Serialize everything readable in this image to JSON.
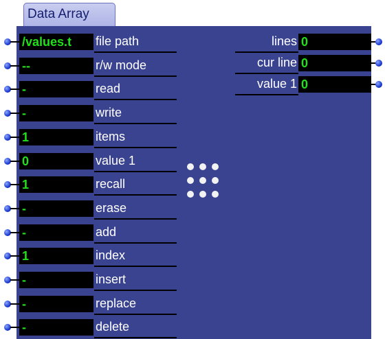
{
  "title": "Data Array",
  "inputs": [
    {
      "value": "/values.t",
      "label": "file path"
    },
    {
      "value": "--",
      "label": "r/w mode"
    },
    {
      "value": "-",
      "label": "read"
    },
    {
      "value": "-",
      "label": "write"
    },
    {
      "value": "1",
      "label": "items"
    },
    {
      "value": "0",
      "label": "value 1"
    },
    {
      "value": "1",
      "label": "recall"
    },
    {
      "value": "-",
      "label": "erase"
    },
    {
      "value": "-",
      "label": "add"
    },
    {
      "value": "1",
      "label": "index"
    },
    {
      "value": "-",
      "label": "insert"
    },
    {
      "value": "-",
      "label": "replace"
    },
    {
      "value": "-",
      "label": "delete"
    }
  ],
  "outputs": [
    {
      "label": "lines",
      "value": "0"
    },
    {
      "label": "cur line",
      "value": "0"
    },
    {
      "label": "value 1",
      "value": "0"
    }
  ]
}
